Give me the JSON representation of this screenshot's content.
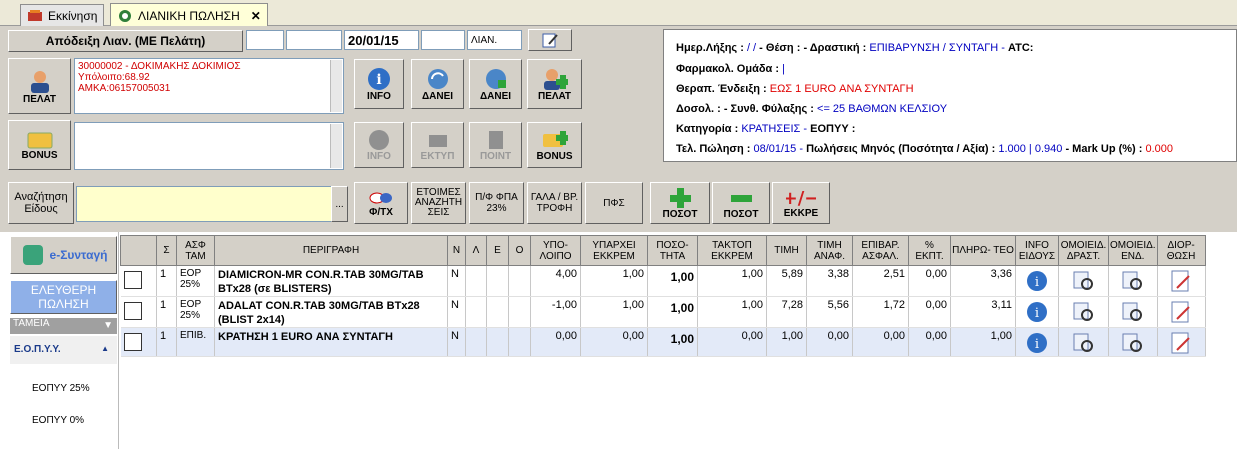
{
  "tabs": [
    {
      "label": "Εκκίνηση"
    },
    {
      "label": "ΛΙΑΝΙΚΗ ΠΩΛΗΣΗ"
    }
  ],
  "receipt": {
    "label": "Απόδειξη Λιαν. (ΜΕ Πελάτη)",
    "date": "20/01/15",
    "type": "ΛΙΑΝ."
  },
  "customer": {
    "button": "ΠΕΛΑΤ",
    "line1": "30000002 - ΔΟΚΙΜΑΚΗΣ ΔΟΚΙΜΙΟΣ",
    "line2": "Υπόλοιπο:68.92",
    "line3": "ΑΜΚΑ:06157005031"
  },
  "toolbar1": {
    "info": "INFO",
    "danei1": "ΔΑΝΕΙ",
    "danei2": "ΔΑΝΕΙ",
    "pelat": "ΠΕΛΑΤ"
  },
  "bonus": {
    "button": "BONUS",
    "info": "INFO",
    "ektyp": "ΕΚΤΥΠ",
    "point": "ΠΟΙΝΤ",
    "bonus2": "BONUS"
  },
  "search": {
    "button": "Αναζήτηση Είδους",
    "ellipsis": "...",
    "fte": "Φ/ΤΧ",
    "etoimes": "ΕΤΟΙΜΕΣ ΑΝΑΖΗΤΗ ΣΕΙΣ",
    "pfpa": "Π/Φ ΦΠΑ 23%",
    "gala": "ΓΑΛΑ / ΒΡ. ΤΡΟΦΗ",
    "pfs": "ΠΦΣ",
    "posot_plus": "ΠΟΣΟΤ",
    "posot_minus": "ΠΟΣΟΤ",
    "ekkre": "ΕΚΚΡΕ"
  },
  "info": {
    "l1_a": "Ημερ.Λήξης :",
    "l1_av": "/ /",
    "l1_b": "- Θέση :",
    "l1_c": "- Δραστική :",
    "l1_cv": "ΕΠΙΒΑΡΥΝΣΗ / ΣΥΝΤΑΓΗ -",
    "l1_d": "ATC:",
    "l2_a": "Φαρμακολ. Ομάδα :",
    "l2_av": "|",
    "l3_a": "Θεραπ. Ένδειξη :",
    "l3_av": "ΕΩΣ 1 EURO ΑΝΑ ΣΥΝΤΑΓΗ",
    "l4_a": "Δοσολ. :",
    "l4_b": "- Συνθ. Φύλαξης :",
    "l4_bv": "<= 25 ΒΑΘΜΩΝ ΚΕΛΣΙΟΥ",
    "l5_a": "Κατηγορία :",
    "l5_av": "ΚΡΑΤΗΣΕΙΣ -",
    "l5_b": "ΕΟΠΥΥ :",
    "l6_a": "Τελ. Πώληση :",
    "l6_av": "08/01/15 -",
    "l6_b": "Πωλήσεις Μηνός (Ποσότητα / Αξία) :",
    "l6_bv": "1.000 | 0.940",
    "l6_c": "- Mark Up (%) :",
    "l6_cv": "0.000"
  },
  "nav": {
    "esyntagi": "e-Συνταγή",
    "eleftheri": "ΕΛΕΥΘΕΡΗ ΠΩΛΗΣΗ",
    "tameia": "ΤΑΜΕΙΑ",
    "eopyy": "Ε.Ο.Π.Υ.Υ.",
    "eopyy25": "ΕΟΠΥΥ 25%",
    "eopyy0": "ΕΟΠΥΥ 0%"
  },
  "columns": [
    "",
    "Σ",
    "ΑΣΦ ΤΑΜ",
    "ΠΕΡΙΓΡΑΦΗ",
    "Ν",
    "Λ",
    "Ε",
    "Ο",
    "ΥΠΟ- ΛΟΙΠΟ",
    "ΥΠΑΡΧΕΙ ΕΚΚΡΕΜ",
    "ΠΟΣΟ- ΤΗΤΑ",
    "ΤΑΚΤΟΠ ΕΚΚΡΕΜ",
    "ΤΙΜΗ",
    "ΤΙΜΗ ΑΝΑΦ.",
    "ΕΠΙΒΑΡ. ΑΣΦΑΛ.",
    "% ΕΚΠΤ.",
    "ΠΛΗΡΩ- ΤΕΟ",
    "INFO ΕΙΔΟΥΣ",
    "ΟΜΟΙΕΙΔ. ΔΡΑΣΤ.",
    "ΟΜΟΙΕΙΔ. ΕΝΔ.",
    "ΔΙΟΡ- ΘΩΣΗ"
  ],
  "rows": [
    {
      "s": "1",
      "asf": "ΕΟΡ 25%",
      "desc": "DIAMICRON-MR CON.R.TAB 30MG/TAB BTx28 (σε BLISTERS)",
      "n": "Ν",
      "ypol": "4,00",
      "yparx": "1,00",
      "pos": "1,00",
      "takt": "1,00",
      "timi": "5,89",
      "anaf": "3,38",
      "epib": "2,51",
      "ekpt": "0,00",
      "plir": "3,36"
    },
    {
      "s": "1",
      "asf": "ΕΟΡ 25%",
      "desc": "ADALAT CON.R.TAB 30MG/TAB BTx28 (BLIST 2x14)",
      "n": "Ν",
      "ypol": "-1,00",
      "yparx": "1,00",
      "pos": "1,00",
      "takt": "1,00",
      "timi": "7,28",
      "anaf": "5,56",
      "epib": "1,72",
      "ekpt": "0,00",
      "plir": "3,11"
    },
    {
      "s": "1",
      "asf": "ΕΠΙΒ.",
      "desc": "ΚΡΑΤΗΣΗ 1 EURO ΑΝΑ ΣΥΝΤΑΓΗ",
      "n": "Ν",
      "ypol": "0,00",
      "yparx": "0,00",
      "pos": "1,00",
      "takt": "0,00",
      "timi": "1,00",
      "anaf": "0,00",
      "epib": "0,00",
      "ekpt": "0,00",
      "plir": "1,00"
    }
  ]
}
